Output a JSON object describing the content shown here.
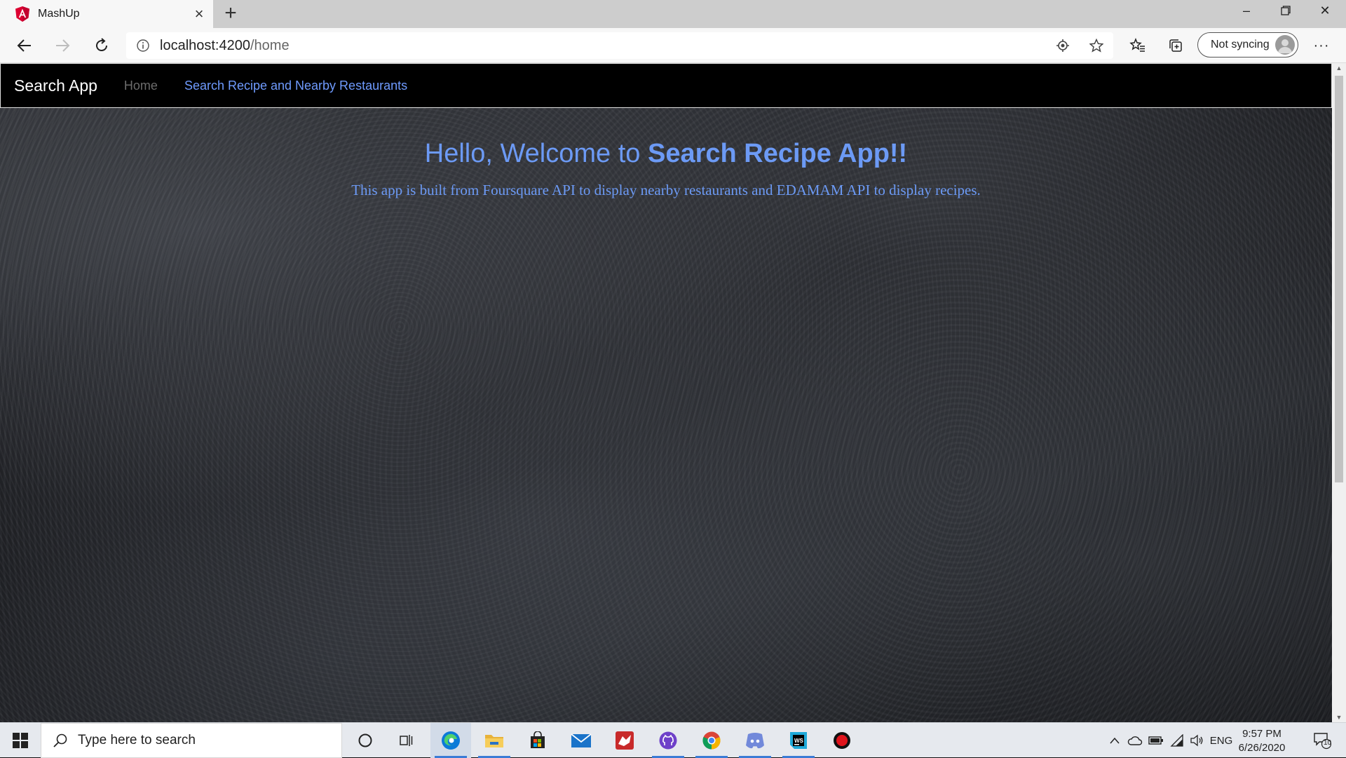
{
  "browser": {
    "tab": {
      "title": "MashUp"
    },
    "address": {
      "host": "localhost:4200",
      "path": "/home"
    },
    "profile": {
      "label": "Not syncing"
    }
  },
  "app": {
    "brand": "Search App",
    "nav": [
      {
        "label": "Home",
        "state": "inactive"
      },
      {
        "label": "Search Recipe and Nearby Restaurants",
        "state": "active"
      }
    ],
    "hero": {
      "greeting": "Hello, Welcome to ",
      "app_name": "Search Recipe App!!",
      "description": "This app is built from Foursquare API to display nearby restaurants and EDAMAM API to display recipes."
    }
  },
  "taskbar": {
    "search_placeholder": "Type here to search",
    "language": "ENG",
    "time": "9:57 PM",
    "date": "6/26/2020",
    "notification_count": "10"
  },
  "colors": {
    "accent_blue": "#6c9af5",
    "nav_background": "#000000",
    "angular_red": "#dd0031"
  }
}
